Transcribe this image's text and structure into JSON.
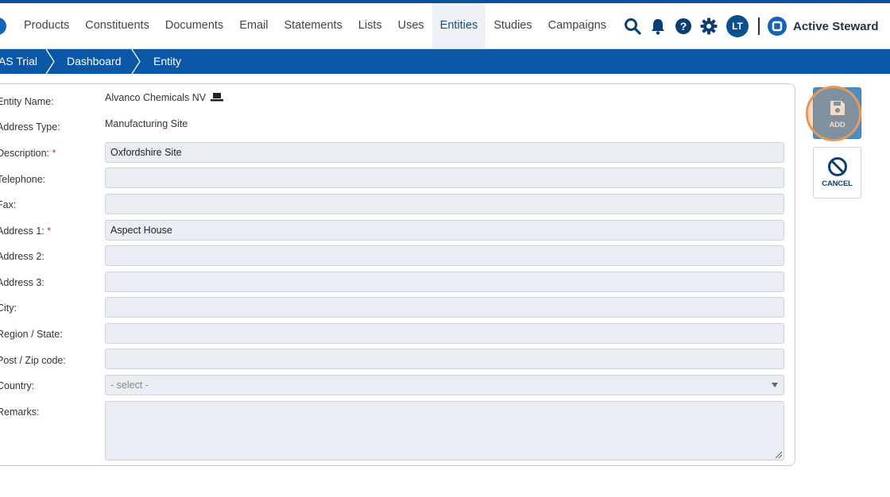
{
  "nav": {
    "items": [
      {
        "label": "Products",
        "active": false
      },
      {
        "label": "Constituents",
        "active": false
      },
      {
        "label": "Documents",
        "active": false
      },
      {
        "label": "Email",
        "active": false
      },
      {
        "label": "Statements",
        "active": false
      },
      {
        "label": "Lists",
        "active": false
      },
      {
        "label": "Uses",
        "active": false
      },
      {
        "label": "Entities",
        "active": true
      },
      {
        "label": "Studies",
        "active": false
      },
      {
        "label": "Campaigns",
        "active": false
      }
    ]
  },
  "header": {
    "avatar_initials": "LT",
    "brand": "Active Steward",
    "icons": [
      "search-icon",
      "bell-icon",
      "help-icon",
      "gear-icon"
    ]
  },
  "breadcrumb": [
    "AS Trial",
    "Dashboard",
    "Entity"
  ],
  "form": {
    "entity_name_label": "Entity Name:",
    "entity_name_value": "Alvanco Chemicals NV",
    "address_type_label": "Address Type:",
    "address_type_value": "Manufacturing Site",
    "description_label": "Description:",
    "description_value": "Oxfordshire Site",
    "telephone_label": "Telephone:",
    "telephone_value": "",
    "fax_label": "Fax:",
    "fax_value": "",
    "address1_label": "Address 1:",
    "address1_value": "Aspect House",
    "address2_label": "Address 2:",
    "address2_value": "",
    "address3_label": "Address 3:",
    "address3_value": "",
    "city_label": "City:",
    "city_value": "",
    "region_label": "Region / State:",
    "region_value": "",
    "postcode_label": "Post / Zip code:",
    "postcode_value": "",
    "country_label": "Country:",
    "country_placeholder": "- select -",
    "remarks_label": "Remarks:",
    "remarks_value": "",
    "required_mark": "*"
  },
  "actions": {
    "add_label": "ADD",
    "cancel_label": "CANCEL"
  },
  "colors": {
    "primary": "#0a57a8",
    "add_button": "#4b8ec4",
    "highlight": "#e59a5a"
  }
}
